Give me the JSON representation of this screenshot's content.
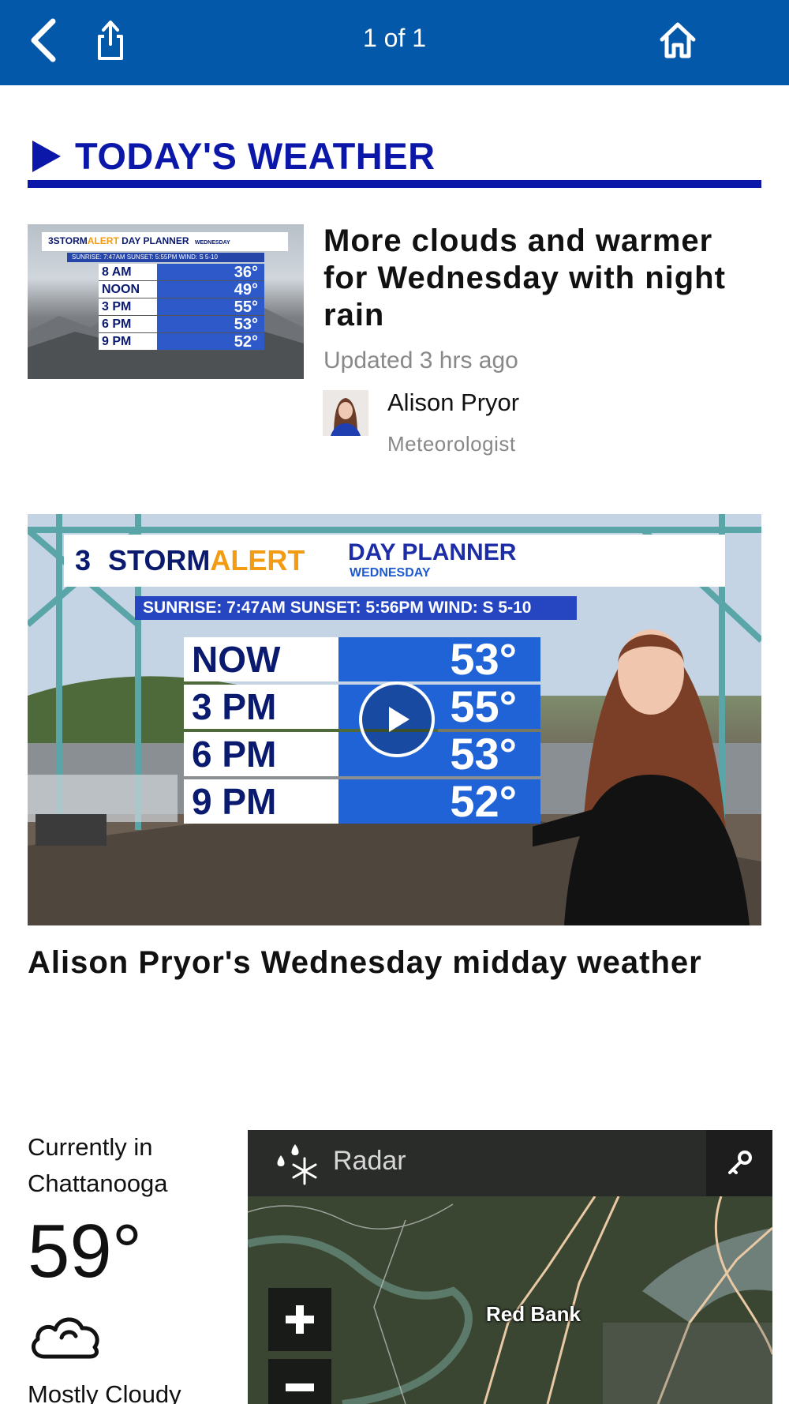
{
  "topbar": {
    "pager": "1 of 1",
    "icons": {
      "back": "chevron-left-icon",
      "share": "share-icon",
      "home": "home-icon"
    },
    "color": "#0458a9"
  },
  "section": {
    "title": "TODAY'S WEATHER",
    "accent": "#0a17a8"
  },
  "story": {
    "title": "More clouds and warmer for Wednesday with night rain",
    "updated": "Updated 3 hrs ago",
    "author_name": "Alison Pryor",
    "author_role": "Meteorologist",
    "thumbnail": {
      "logo_brand_start": "3STORM",
      "logo_brand_alert": "ALERT",
      "logo_suffix": "DAY PLANNER",
      "day": "WEDNESDAY",
      "sub": "SUNRISE: 7:47AM   SUNSET: 5:55PM   WIND: S 5-10",
      "rows": [
        {
          "time": "8 AM",
          "temp": "36°"
        },
        {
          "time": "NOON",
          "temp": "49°"
        },
        {
          "time": "3 PM",
          "temp": "55°"
        },
        {
          "time": "6 PM",
          "temp": "53°"
        },
        {
          "time": "9 PM",
          "temp": "52°"
        }
      ]
    }
  },
  "video": {
    "title": "Alison Pryor's Wednesday midday weather",
    "banner": {
      "logo3": "3",
      "storm": "STORM",
      "alert": "ALERT",
      "planner": "DAY PLANNER",
      "day": "WEDNESDAY",
      "sunbar": "SUNRISE: 7:47AM   SUNSET: 5:56PM   WIND: S 5-10"
    },
    "rows": [
      {
        "time": "NOW",
        "temp": "53°"
      },
      {
        "time": "3 PM",
        "temp": "55°"
      },
      {
        "time": "6 PM",
        "temp": "53°"
      },
      {
        "time": "9 PM",
        "temp": "52°"
      }
    ]
  },
  "current": {
    "label": "Currently in Chattanooga",
    "temp": "59°",
    "condition": "Mostly Cloudy",
    "icon": "cloud-icon"
  },
  "radar": {
    "label": "Radar",
    "place": "Red Bank",
    "zoom_in": "+",
    "zoom_out": "−"
  }
}
